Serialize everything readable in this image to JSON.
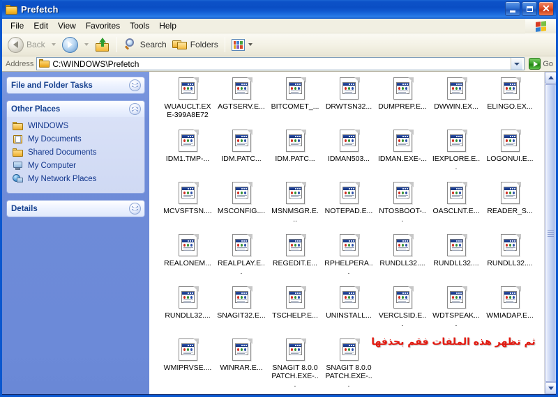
{
  "window": {
    "title": "Prefetch",
    "icon": "folder-icon",
    "buttons": {
      "minimize": "_",
      "maximize": "❐",
      "close": "✕"
    }
  },
  "menubar": {
    "items": [
      "File",
      "Edit",
      "View",
      "Favorites",
      "Tools",
      "Help"
    ],
    "brand_icon": "windows-flag-icon"
  },
  "toolbar": {
    "back_label": "Back",
    "forward_label": "",
    "up_label": "",
    "search_label": "Search",
    "folders_label": "Folders",
    "views_label": ""
  },
  "address": {
    "label": "Address",
    "value": "C:\\WINDOWS\\Prefetch",
    "go_label": "Go"
  },
  "taskpane": {
    "panels": [
      {
        "title": "File and Folder Tasks",
        "state": "collapsed",
        "items": []
      },
      {
        "title": "Other Places",
        "state": "expanded",
        "items": [
          {
            "label": "WINDOWS",
            "icon": "folder-icon"
          },
          {
            "label": "My Documents",
            "icon": "my-documents-icon"
          },
          {
            "label": "Shared Documents",
            "icon": "folder-icon"
          },
          {
            "label": "My Computer",
            "icon": "my-computer-icon"
          },
          {
            "label": "My Network Places",
            "icon": "network-places-icon"
          }
        ]
      },
      {
        "title": "Details",
        "state": "collapsed",
        "items": []
      }
    ]
  },
  "files": [
    {
      "name": "WUAUCLT.EXE-399A8E72"
    },
    {
      "name": "AGTSERV.E..."
    },
    {
      "name": "BITCOMET_..."
    },
    {
      "name": "DRWTSN32..."
    },
    {
      "name": "DUMPREP.E..."
    },
    {
      "name": "DWWIN.EX..."
    },
    {
      "name": "ELINGO.EX..."
    },
    {
      "name": "IDM1.TMP-..."
    },
    {
      "name": "IDM.PATC..."
    },
    {
      "name": "IDM.PATC..."
    },
    {
      "name": "IDMAN503..."
    },
    {
      "name": "IDMAN.EXE-..."
    },
    {
      "name": "IEXPLORE.E..."
    },
    {
      "name": "LOGONUI.E..."
    },
    {
      "name": "MCVSFTSN...."
    },
    {
      "name": "MSCONFIG...."
    },
    {
      "name": "MSNMSGR.E..."
    },
    {
      "name": "NOTEPAD.E..."
    },
    {
      "name": "NTOSBOOT-..."
    },
    {
      "name": "OASCLNT.E..."
    },
    {
      "name": "READER_S..."
    },
    {
      "name": "REALONEM..."
    },
    {
      "name": "REALPLAY.E..."
    },
    {
      "name": "REGEDIT.E..."
    },
    {
      "name": "RPHELPERA..."
    },
    {
      "name": "RUNDLL32...."
    },
    {
      "name": "RUNDLL32...."
    },
    {
      "name": "RUNDLL32...."
    },
    {
      "name": "RUNDLL32...."
    },
    {
      "name": "SNAGIT32.E..."
    },
    {
      "name": "TSCHELP.E..."
    },
    {
      "name": "UNINSTALL..."
    },
    {
      "name": "VERCLSID.E..."
    },
    {
      "name": "WDTSPEAK...."
    },
    {
      "name": "WMIADAP.E..."
    },
    {
      "name": "WMIPRVSE...."
    },
    {
      "name": "WINRAR.E..."
    },
    {
      "name": "SNAGIT 8.0.0 PATCH.EXE-..."
    },
    {
      "name": "SNAGIT 8.0.0 PATCH.EXE-..."
    }
  ],
  "annotation": {
    "text": "ثم تظهر هذه الملفات فقم بحذفها",
    "color": "#e3190f"
  },
  "scrollbar": {
    "up_icon": "chevron-up-icon",
    "down_icon": "chevron-down-icon"
  }
}
